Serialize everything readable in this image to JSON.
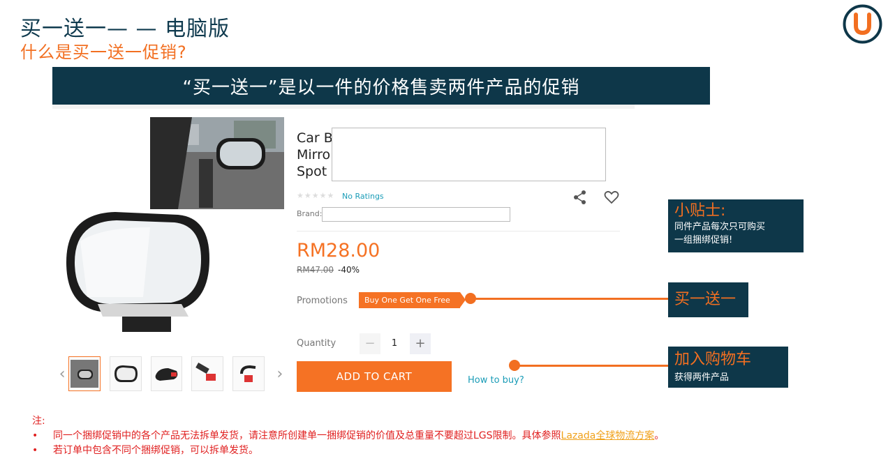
{
  "header": {
    "title": "买一送一— — 电脑版",
    "subtitle": "什么是买一送一促销?"
  },
  "logo": {
    "icon": "u-logo-icon",
    "color": "#f26f21",
    "ring_color": "#0e3749"
  },
  "banner": {
    "text": "“买一送一”是以一件的价格售卖两件产品的促销"
  },
  "product": {
    "title_partial": "Car B\nMirro\nSpot",
    "rating_text": "No Ratings",
    "brand_label": "Brand:",
    "price": "RM28.00",
    "original_price": "RM47.00",
    "discount": "-40%",
    "promotions_label": "Promotions",
    "promo_badge": "Buy One Get One Free",
    "quantity_label": "Quantity",
    "quantity_minus": "−",
    "quantity_value": "1",
    "quantity_plus": "+",
    "add_to_cart": "ADD TO CART",
    "how_to_buy": "How to buy?",
    "thumb_prev": "‹",
    "thumb_next": "›"
  },
  "callouts": {
    "tip_title": "小贴士:",
    "tip_body_1": "同件产品每次只可购买",
    "tip_body_2": "一组捆绑促销!",
    "bogo": "买一送一",
    "cart_title": "加入购物车",
    "cart_body": "获得两件产品"
  },
  "notes": {
    "label": "注:",
    "bullet": "•",
    "item1_text": "同一个捆绑促销中的各个产品无法拆单发货，请注意所创建单一捆绑促销的价值及总重量不要超过LGS限制。具体参照",
    "item1_link": "Lazada全球物流方案",
    "item1_end": "。",
    "item2_text": "若订单中包含不同个捆绑促销，可以拆单发货。"
  },
  "colors": {
    "accent": "#f26f21",
    "navy": "#0e3749",
    "lazada_orange": "#f57224",
    "note_red": "#e02020"
  }
}
